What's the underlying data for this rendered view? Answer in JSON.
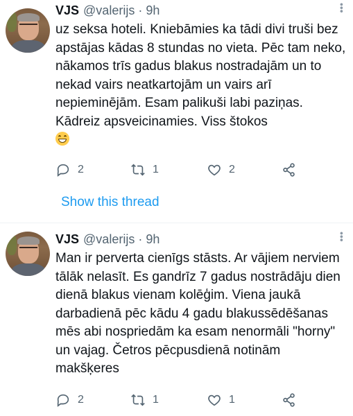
{
  "tweets": [
    {
      "name": "VJS",
      "handle": "@valerijs",
      "separator": "·",
      "time": "9h",
      "text": "uz seksa hoteli. Kniebāmies ka tādi divi truši bez apstājas kādas 8 stundas no vieta. Pēc tam neko, nākamos trīs gadus blakus nostradajām un to nekad vairs neatkartojām un vairs arī nepieminējām. Esam palikuši labi paziņas. Kādreiz apsveicinamies. Viss štokos",
      "emoji": "grinning-face-emoji",
      "replies": "2",
      "retweets": "1",
      "likes": "2",
      "show_thread": "Show this thread"
    },
    {
      "name": "VJS",
      "handle": "@valerijs",
      "separator": "·",
      "time": "9h",
      "text": "Man ir perverta cienīgs stāsts. Ar vājiem nerviem tālāk nelasīt. Es gandrīz 7 gadus nostrādāju dien dienā blakus vienam kolēģim. Viena jaukā darbadienā pēc kādu 4 gadu blakussēdēšanas mēs abi nospriedām ka esam nenormāli \"horny\" un vajag. Četros pēcpusdienā notinām makšķeres",
      "replies": "2",
      "retweets": "1",
      "likes": "1"
    }
  ],
  "colors": {
    "link": "#1d9bf0",
    "secondary": "#536471",
    "text": "#0f1419",
    "divider": "#eff3f4"
  },
  "icons": [
    "reply-icon",
    "retweet-icon",
    "like-icon",
    "share-icon",
    "more-icon"
  ]
}
